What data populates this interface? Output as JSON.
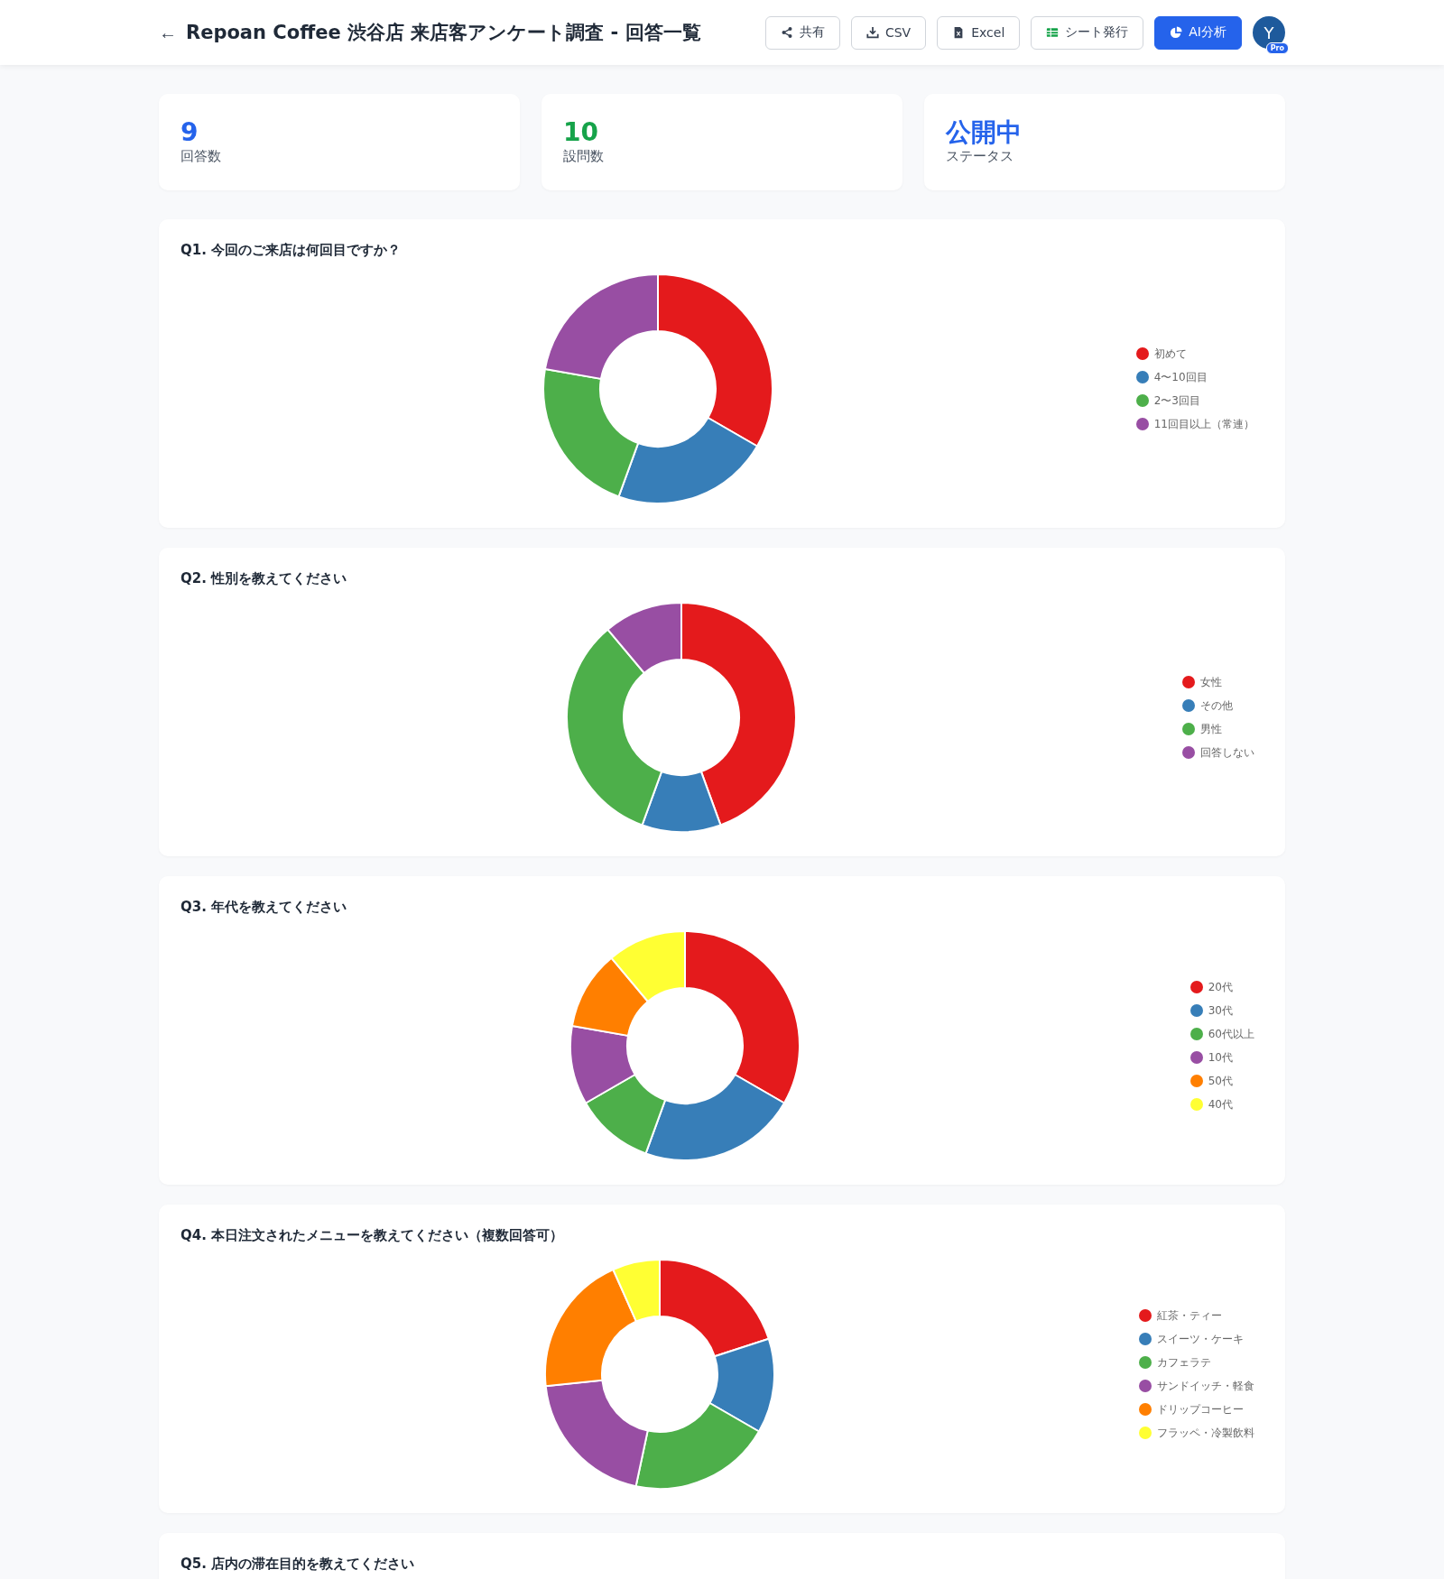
{
  "header": {
    "back": "←",
    "title": "Repoan Coffee 渋谷店 来店客アンケート調査 - 回答一覧",
    "buttons": [
      {
        "kind": "share",
        "label": "共有"
      },
      {
        "kind": "download",
        "label": "CSV"
      },
      {
        "kind": "file",
        "label": "Excel"
      },
      {
        "kind": "sheet",
        "label": "シート発行"
      },
      {
        "kind": "ai",
        "label": "AI分析"
      }
    ],
    "avatar": {
      "initial": "Y",
      "badge": "Pro"
    }
  },
  "stats": [
    {
      "value": "9",
      "label": "回答数",
      "color": "#2563eb"
    },
    {
      "value": "10",
      "label": "設問数",
      "color": "#16a34a"
    },
    {
      "value": "公開中",
      "label": "ステータス",
      "color": "#2563eb"
    }
  ],
  "questions": [
    {
      "title": "Q1. 今回のご来店は何回目ですか？",
      "legend": [
        {
          "label": "初めて",
          "color": "#e41a1c"
        },
        {
          "label": "4〜10回目",
          "color": "#377eb8"
        },
        {
          "label": "2〜3回目",
          "color": "#4daf4a"
        },
        {
          "label": "11回目以上（常連）",
          "color": "#984ea3"
        }
      ]
    },
    {
      "title": "Q2. 性別を教えてください",
      "legend": [
        {
          "label": "女性",
          "color": "#e41a1c"
        },
        {
          "label": "その他",
          "color": "#377eb8"
        },
        {
          "label": "男性",
          "color": "#4daf4a"
        },
        {
          "label": "回答しない",
          "color": "#984ea3"
        }
      ]
    },
    {
      "title": "Q3. 年代を教えてください",
      "legend": [
        {
          "label": "20代",
          "color": "#e41a1c"
        },
        {
          "label": "30代",
          "color": "#377eb8"
        },
        {
          "label": "60代以上",
          "color": "#4daf4a"
        },
        {
          "label": "10代",
          "color": "#984ea3"
        },
        {
          "label": "50代",
          "color": "#ff7f00"
        },
        {
          "label": "40代",
          "color": "#ffff33"
        }
      ]
    },
    {
      "title": "Q4. 本日注文されたメニューを教えてください（複数回答可）",
      "legend": [
        {
          "label": "紅茶・ティー",
          "color": "#e41a1c"
        },
        {
          "label": "スイーツ・ケーキ",
          "color": "#377eb8"
        },
        {
          "label": "カフェラテ",
          "color": "#4daf4a"
        },
        {
          "label": "サンドイッチ・軽食",
          "color": "#984ea3"
        },
        {
          "label": "ドリップコーヒー",
          "color": "#ff7f00"
        },
        {
          "label": "フラッペ・冷製飲料",
          "color": "#ffff33"
        }
      ]
    },
    {
      "title": "Q5. 店内の滞在目的を教えてください"
    }
  ]
}
